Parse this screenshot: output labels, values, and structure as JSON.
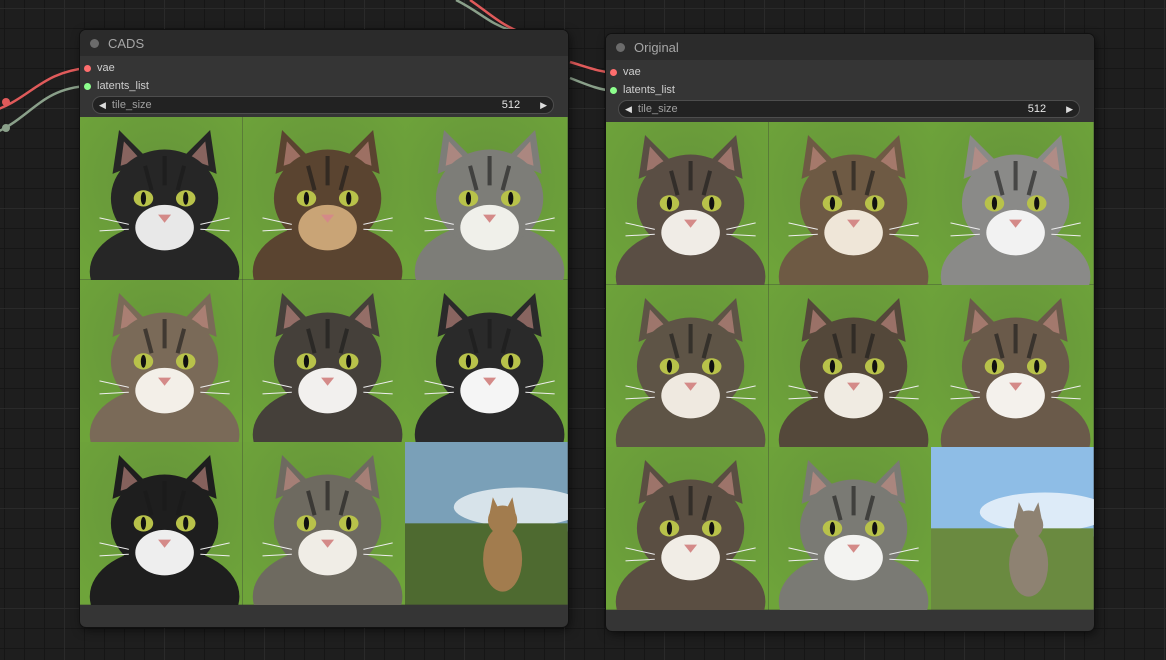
{
  "nodes": [
    {
      "title": "CADS",
      "inputs": [
        {
          "label": "vae",
          "color": "#ff6e6e"
        },
        {
          "label": "latents_list",
          "color": "#8dff8d"
        }
      ],
      "widget": {
        "label": "tile_size",
        "value": "512"
      },
      "images": [
        {
          "subject": "black-white-cat",
          "bg": "#6ea43a",
          "fur": "#262626",
          "accent": "#e8e8e8"
        },
        {
          "subject": "tabby-cat-closeup",
          "bg": "#8c6c4a",
          "fur": "#5a4430",
          "accent": "#c9a476"
        },
        {
          "subject": "gray-tabby-cat",
          "bg": "#4e7a2e",
          "fur": "#7d7d78",
          "accent": "#f0f0ea"
        },
        {
          "subject": "tabby-cat",
          "bg": "#5e2a18",
          "fur": "#7a6a58",
          "accent": "#f3efe8"
        },
        {
          "subject": "tabby-white-cat",
          "bg": "#6e5a48",
          "fur": "#45403a",
          "accent": "#f2f0ee"
        },
        {
          "subject": "black-white-cat",
          "bg": "#4a7a24",
          "fur": "#2a2a2a",
          "accent": "#f5f5f5"
        },
        {
          "subject": "black-cat",
          "bg": "#c9b9a5",
          "fur": "#1e1e1e",
          "accent": "#eeeeee"
        },
        {
          "subject": "tabby-cat-window",
          "bg": "#5a7a3e",
          "fur": "#6e6a60",
          "accent": "#f0ede6"
        },
        {
          "subject": "cat-on-grass",
          "bg": "#4e6a30",
          "fur": "#a27c4e",
          "accent": "#7aa0b8"
        }
      ]
    },
    {
      "title": "Original",
      "inputs": [
        {
          "label": "vae",
          "color": "#ff6e6e"
        },
        {
          "label": "latents_list",
          "color": "#8dff8d"
        }
      ],
      "widget": {
        "label": "tile_size",
        "value": "512"
      },
      "images": [
        {
          "subject": "tabby-white-cat",
          "bg": "#4f8a2a",
          "fur": "#5a4e44",
          "accent": "#f0ece6"
        },
        {
          "subject": "tabby-cat-closeup",
          "bg": "#c7a472",
          "fur": "#6e5a44",
          "accent": "#efe6d8"
        },
        {
          "subject": "gray-cat",
          "bg": "#4a7a2a",
          "fur": "#8a8a88",
          "accent": "#f2f2f2"
        },
        {
          "subject": "tabby-cat-closeup",
          "bg": "#8a7a66",
          "fur": "#5e5446",
          "accent": "#efe9e0"
        },
        {
          "subject": "tabby-cat-closeup",
          "bg": "#7a6a54",
          "fur": "#54483a",
          "accent": "#f0ebe2"
        },
        {
          "subject": "tabby-cat",
          "bg": "#7fb4a6",
          "fur": "#6a5a4a",
          "accent": "#f4f1ec"
        },
        {
          "subject": "tabby-cat-closeup",
          "bg": "#c8c0b4",
          "fur": "#5a4e42",
          "accent": "#f1ede6"
        },
        {
          "subject": "tabby-cat",
          "bg": "#4a8a26",
          "fur": "#7a7a74",
          "accent": "#f3f3f1"
        },
        {
          "subject": "cat-in-field",
          "bg": "#6a8a40",
          "fur": "#8e8272",
          "accent": "#8ebde6"
        }
      ]
    }
  ]
}
